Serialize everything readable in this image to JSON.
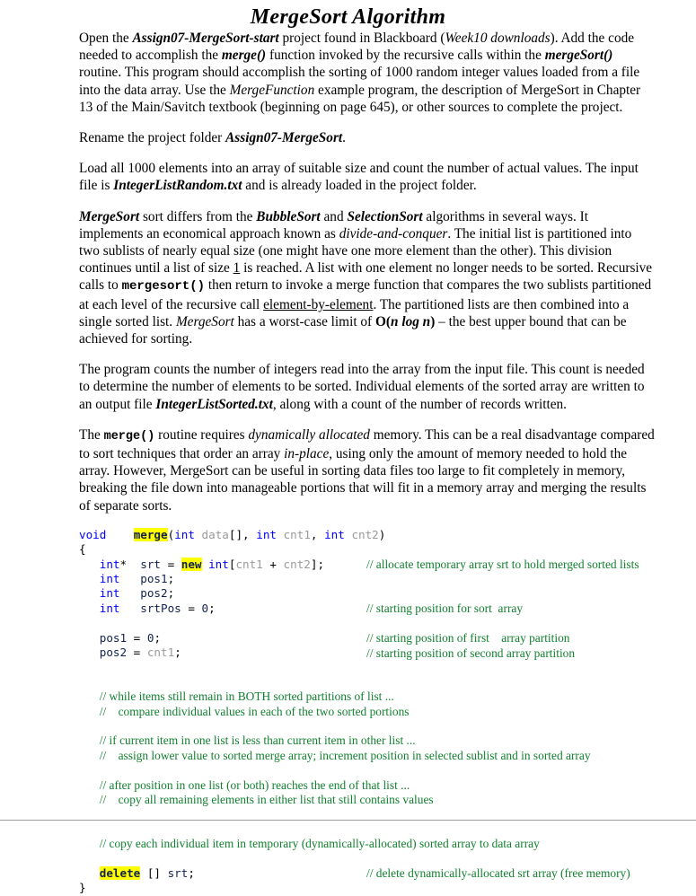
{
  "document": {
    "title": "MergeSort Algorithm"
  },
  "paragraphs": {
    "p1": {
      "seg1": "Open the ",
      "seg2": "Assign07-MergeSort-start",
      "seg3": " project found in Blackboard (",
      "seg4": "Week10 downloads",
      "seg5": ").  Add the code needed to accomplish the ",
      "seg6": "merge()",
      "seg7": " function invoked by the recursive calls within the ",
      "seg8": "mergeSort()",
      "seg9": " routine. This program should accomplish the sorting of 1000 random integer values loaded from a file into the data array.  Use the ",
      "seg10": "MergeFunction",
      "seg11": " example program, the description of MergeSort in Chapter 13 of the Main/Savitch textbook (beginning on page 645), or other sources to complete the project."
    },
    "p2": {
      "seg1": "Rename the project folder ",
      "seg2": "Assign07-MergeSort",
      "seg3": "."
    },
    "p3": {
      "seg1": "Load all 1000 elements into an array of suitable size and count the number of actual values.  The input file is ",
      "seg2": "IntegerListRandom.txt",
      "seg3": " and is already loaded in the project folder."
    },
    "p4": {
      "seg1": "MergeSort",
      "seg2": " sort differs from the ",
      "seg3": "BubbleSort",
      "seg4": " and ",
      "seg5": "SelectionSort",
      "seg6": " algorithms in several ways.  It implements an economical approach known as ",
      "seg7": "divide-and-conquer",
      "seg8": ".  The initial list is partitioned into two sublists of nearly equal size (one might have one more element than the other).  This division continues until a list of size ",
      "seg9": "1",
      "seg10": " is reached. A list with one element no longer needs to be sorted.  Recursive calls to ",
      "seg11": "mergesort()",
      "seg12": " then return to invoke a merge function that compares the two sublists partitioned at each level of the recursive call ",
      "seg13": "element-by-element",
      "seg14": ".  The partitioned lists are then combined into a single sorted list. ",
      "seg15": "MergeSort",
      "seg16": " has a worst-case limit of  ",
      "seg17": "O(",
      "seg18": "n log n",
      "seg19": ")",
      "seg20": " – the best upper bound that can be achieved for sorting."
    },
    "p5": {
      "seg1": "The program counts the number of integers read into the array from the input file.  This count is needed to determine the number of elements to be sorted.  Individual elements of the sorted array are written to an output file ",
      "seg2": "IntegerListSorted.txt",
      "seg3": ", along with a count of the number of records written."
    },
    "p6": {
      "seg1": "The ",
      "seg2": "merge()",
      "seg3": " routine requires ",
      "seg4": "dynamically allocated",
      "seg5": " memory.  This can be a real disadvantage compared to sort techniques that order an array ",
      "seg6": "in-place",
      "seg7": ", using only the amount of memory needed to hold the array.  However, MergeSort can be useful in sorting data files too large to fit completely in memory, breaking the file down into manageable portions that will fit in a memory array and merging the results of separate sorts."
    }
  },
  "code": {
    "lines": [
      {
        "tokens": [
          {
            "t": "void",
            "c": "kw"
          },
          {
            "t": "    ",
            "c": "punc"
          },
          {
            "t": "merge",
            "c": "hl"
          },
          {
            "t": "(",
            "c": "punc"
          },
          {
            "t": "int",
            "c": "kw"
          },
          {
            "t": " ",
            "c": "punc"
          },
          {
            "t": "data",
            "c": "idg"
          },
          {
            "t": "[], ",
            "c": "punc"
          },
          {
            "t": "int",
            "c": "kw"
          },
          {
            "t": " ",
            "c": "punc"
          },
          {
            "t": "cnt1",
            "c": "idg"
          },
          {
            "t": ", ",
            "c": "punc"
          },
          {
            "t": "int",
            "c": "kw"
          },
          {
            "t": " ",
            "c": "punc"
          },
          {
            "t": "cnt2",
            "c": "idg"
          },
          {
            "t": ")",
            "c": "punc"
          }
        ],
        "comment": ""
      },
      {
        "tokens": [
          {
            "t": "{",
            "c": "punc"
          }
        ],
        "comment": ""
      },
      {
        "tokens": [
          {
            "t": "   ",
            "c": "punc"
          },
          {
            "t": "int",
            "c": "kw"
          },
          {
            "t": "*  ",
            "c": "punc"
          },
          {
            "t": "srt",
            "c": "idn"
          },
          {
            "t": " = ",
            "c": "punc"
          },
          {
            "t": "new",
            "c": "hl"
          },
          {
            "t": " ",
            "c": "punc"
          },
          {
            "t": "int",
            "c": "kw"
          },
          {
            "t": "[",
            "c": "punc"
          },
          {
            "t": "cnt1",
            "c": "idg"
          },
          {
            "t": " + ",
            "c": "punc"
          },
          {
            "t": "cnt2",
            "c": "idg"
          },
          {
            "t": "];",
            "c": "punc"
          }
        ],
        "comment": "// allocate temporary array srt to hold merged sorted lists"
      },
      {
        "tokens": [
          {
            "t": "   ",
            "c": "punc"
          },
          {
            "t": "int",
            "c": "kw"
          },
          {
            "t": "   ",
            "c": "punc"
          },
          {
            "t": "pos1",
            "c": "idn"
          },
          {
            "t": ";",
            "c": "punc"
          }
        ],
        "comment": ""
      },
      {
        "tokens": [
          {
            "t": "   ",
            "c": "punc"
          },
          {
            "t": "int",
            "c": "kw"
          },
          {
            "t": "   ",
            "c": "punc"
          },
          {
            "t": "pos2",
            "c": "idn"
          },
          {
            "t": ";",
            "c": "punc"
          }
        ],
        "comment": ""
      },
      {
        "tokens": [
          {
            "t": "   ",
            "c": "punc"
          },
          {
            "t": "int",
            "c": "kw"
          },
          {
            "t": "   ",
            "c": "punc"
          },
          {
            "t": "srtPos",
            "c": "idn"
          },
          {
            "t": " = ",
            "c": "punc"
          },
          {
            "t": "0",
            "c": "num"
          },
          {
            "t": ";",
            "c": "punc"
          }
        ],
        "comment": "// starting position for sort  array"
      },
      {
        "tokens": [],
        "comment": ""
      },
      {
        "tokens": [
          {
            "t": "   ",
            "c": "punc"
          },
          {
            "t": "pos1",
            "c": "idn"
          },
          {
            "t": " = ",
            "c": "punc"
          },
          {
            "t": "0",
            "c": "num"
          },
          {
            "t": ";",
            "c": "punc"
          }
        ],
        "comment": "// starting position of first    array partition"
      },
      {
        "tokens": [
          {
            "t": "   ",
            "c": "punc"
          },
          {
            "t": "pos2",
            "c": "idn"
          },
          {
            "t": " = ",
            "c": "punc"
          },
          {
            "t": "cnt1",
            "c": "idg"
          },
          {
            "t": ";",
            "c": "punc"
          }
        ],
        "comment": "// starting position of second array partition"
      },
      {
        "tokens": [],
        "comment": ""
      },
      {
        "tokens": [],
        "comment": ""
      },
      {
        "tokens": [
          {
            "t": "   ",
            "c": "punc"
          }
        ],
        "comment_inline": "// while items still remain in BOTH sorted partitions of list ..."
      },
      {
        "tokens": [
          {
            "t": "   ",
            "c": "punc"
          }
        ],
        "comment_inline": "//    compare individual values in each of the two sorted portions"
      },
      {
        "tokens": [],
        "comment": ""
      },
      {
        "tokens": [
          {
            "t": "   ",
            "c": "punc"
          }
        ],
        "comment_inline": "// if current item in one list is less than current item in other list ..."
      },
      {
        "tokens": [
          {
            "t": "   ",
            "c": "punc"
          }
        ],
        "comment_inline": "//    assign lower value to sorted merge array; increment position in selected sublist and in sorted array"
      },
      {
        "tokens": [],
        "comment": ""
      },
      {
        "tokens": [
          {
            "t": "   ",
            "c": "punc"
          }
        ],
        "comment_inline": "// after position in one list (or both) reaches the end of that list ..."
      },
      {
        "tokens": [
          {
            "t": "   ",
            "c": "punc"
          }
        ],
        "comment_inline": "//    copy all remaining elements in either list that still contains values"
      },
      {
        "tokens": [],
        "comment": ""
      },
      {
        "tokens": [],
        "comment": ""
      },
      {
        "tokens": [
          {
            "t": "   ",
            "c": "punc"
          }
        ],
        "comment_inline": "// copy each individual item in temporary (dynamically-allocated) sorted array to data array"
      },
      {
        "tokens": [],
        "comment": ""
      },
      {
        "tokens": [
          {
            "t": "   ",
            "c": "punc"
          },
          {
            "t": "delete",
            "c": "hl"
          },
          {
            "t": " [] ",
            "c": "punc"
          },
          {
            "t": "srt",
            "c": "idn"
          },
          {
            "t": ";",
            "c": "punc"
          }
        ],
        "comment": "// delete dynamically-allocated srt array (free memory)"
      },
      {
        "tokens": [
          {
            "t": "}",
            "c": "punc"
          }
        ],
        "comment": ""
      }
    ]
  },
  "colors": {
    "keyword": "#0000ff",
    "identifier_gray": "#9a9a9a",
    "identifier_navy": "#11224c",
    "comment_green": "#12802f",
    "highlight": "#ffff00",
    "rule": "#9c9c9c"
  }
}
